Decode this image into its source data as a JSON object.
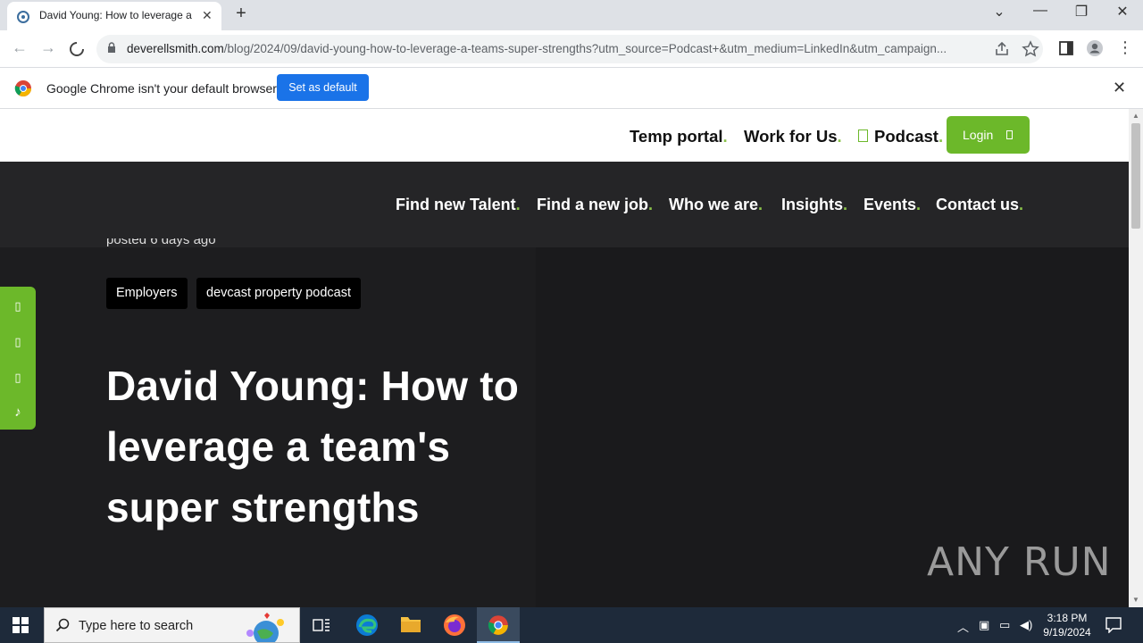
{
  "browser": {
    "tab_title": "David Young: How to leverage a",
    "new_tab": "+",
    "url_domain": "deverellsmith.com",
    "url_path": "/blog/2024/09/david-young-how-to-leverage-a-teams-super-strengths?utm_source=Podcast+&utm_medium=LinkedIn&utm_campaign...",
    "infobar_message": "Google Chrome isn't your default browser",
    "set_default_label": "Set as default"
  },
  "site": {
    "top_nav": [
      {
        "label": "Temp portal",
        "dot": "."
      },
      {
        "label": "Work for Us",
        "dot": "."
      },
      {
        "label": "Podcast",
        "dot": "."
      }
    ],
    "login_label": "Login",
    "main_nav": [
      {
        "label": "Find new Talent",
        "dot": "."
      },
      {
        "label": "Find a new job",
        "dot": "."
      },
      {
        "label": "Who we are",
        "dot": "."
      },
      {
        "label": "Insights",
        "dot": "."
      },
      {
        "label": "Events",
        "dot": "."
      },
      {
        "label": "Contact us",
        "dot": "."
      }
    ],
    "posted": "posted 6 days ago",
    "tags": [
      "Employers",
      "devcast property podcast"
    ],
    "headline": "David Young: How to leverage a team's super strengths",
    "accent_color": "#6cb82a"
  },
  "watermark": "ANY RUN",
  "taskbar": {
    "search_placeholder": "Type here to search",
    "time": "3:18 PM",
    "date": "9/19/2024"
  }
}
